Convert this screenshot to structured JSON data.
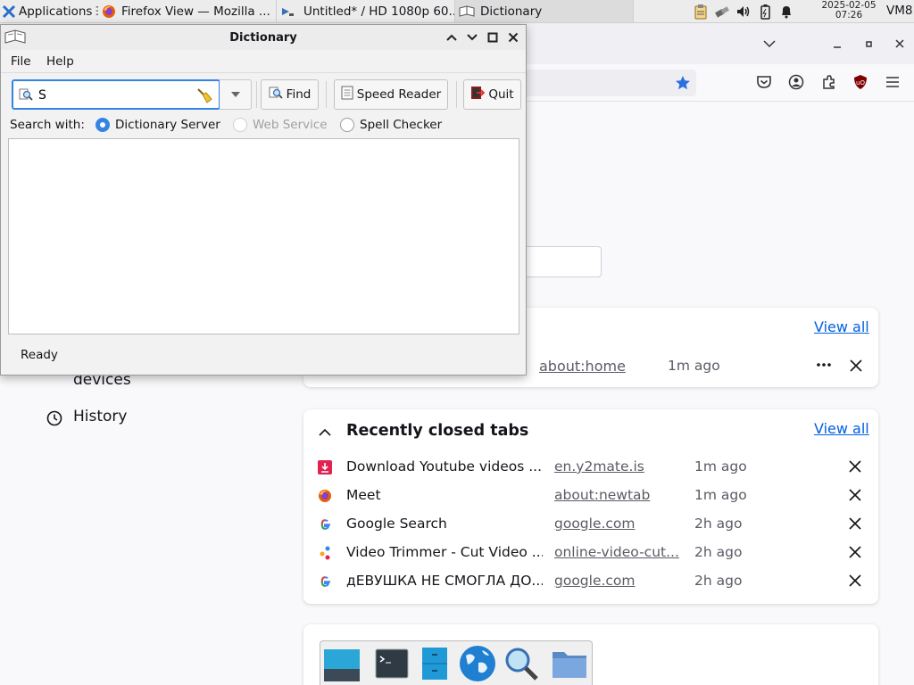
{
  "taskbar": {
    "apps_label": "Applications",
    "tasks": [
      {
        "label": "Firefox View — Mozilla ...",
        "icon": "firefox-icon"
      },
      {
        "label": "Untitled* / HD 1080p 60...",
        "icon": "video-editor-icon"
      },
      {
        "label": "Dictionary",
        "icon": "dictionary-icon"
      }
    ],
    "clock_date": "2025-02-05",
    "clock_time": "07:26",
    "vm_label": "VM8"
  },
  "dictionary": {
    "title": "Dictionary",
    "menu": [
      "File",
      "Help"
    ],
    "search_value": "S",
    "buttons": {
      "find": "Find",
      "speed_reader": "Speed Reader",
      "quit": "Quit"
    },
    "search_with_label": "Search with:",
    "options": [
      {
        "label": "Dictionary Server",
        "selected": true,
        "enabled": true
      },
      {
        "label": "Web Service",
        "selected": false,
        "enabled": false
      },
      {
        "label": "Spell Checker",
        "selected": false,
        "enabled": true
      }
    ],
    "status": "Ready"
  },
  "firefox": {
    "sidebar": {
      "devices_label": "devices",
      "history_label": "History"
    },
    "open_tabs": {
      "view_all": "View all",
      "row": {
        "url": "about:home",
        "time": "1m ago"
      }
    },
    "recently_closed": {
      "heading": "Recently closed tabs",
      "view_all": "View all",
      "rows": [
        {
          "title": "Download Youtube videos ...",
          "url": "en.y2mate.is",
          "time": "1m ago",
          "favicon": "download-icon"
        },
        {
          "title": "Meet",
          "url": "about:newtab",
          "time": "1m ago",
          "favicon": "firefox-icon"
        },
        {
          "title": "Google Search",
          "url": "google.com",
          "time": "2h ago",
          "favicon": "google-icon"
        },
        {
          "title": "Video Trimmer - Cut Video ...",
          "url": "online-video-cut...",
          "time": "2h ago",
          "favicon": "video-trimmer-icon"
        },
        {
          "title": "дЕВУШКА НЕ СМОГЛА ДО...",
          "url": "google.com",
          "time": "2h ago",
          "favicon": "google-icon"
        }
      ]
    }
  },
  "colors": {
    "accent": "#3584e4",
    "ff_link": "#0060df"
  }
}
